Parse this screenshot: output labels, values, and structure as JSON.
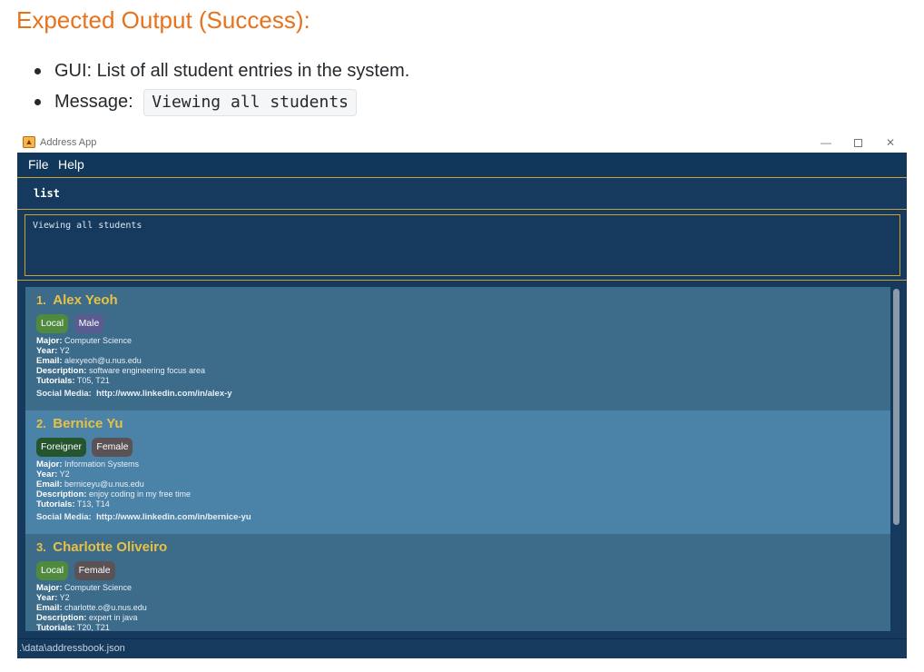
{
  "doc": {
    "heading": "Expected Output (Success):",
    "bullets": [
      "GUI: List of all student entries in the system.",
      "Message:"
    ],
    "message_code": "Viewing all students"
  },
  "window": {
    "title": "Address App",
    "minimize": "—",
    "close": "✕"
  },
  "menu": {
    "file": "File",
    "help": "Help"
  },
  "command": {
    "value": "list"
  },
  "result": {
    "text": "Viewing all students"
  },
  "labels": {
    "major": "Major:",
    "year": "Year:",
    "email": "Email:",
    "description": "Description:",
    "tutorials": "Tutorials:",
    "social": "Social Media:"
  },
  "students": [
    {
      "index": "1.",
      "name": "Alex Yeoh",
      "tags": [
        "Local",
        "Male"
      ],
      "major": "Computer Science",
      "year": "Y2",
      "email": "alexyeoh@u.nus.edu",
      "description": "software engineering focus area",
      "tutorials": "T05, T21",
      "social": "http://www.linkedin.com/in/alex-y"
    },
    {
      "index": "2.",
      "name": "Bernice Yu",
      "tags": [
        "Foreigner",
        "Female"
      ],
      "major": "Information Systems",
      "year": "Y2",
      "email": "berniceyu@u.nus.edu",
      "description": "enjoy coding in my free time",
      "tutorials": "T13, T14",
      "social": "http://www.linkedin.com/in/bernice-yu"
    },
    {
      "index": "3.",
      "name": "Charlotte Oliveiro",
      "tags": [
        "Local",
        "Female"
      ],
      "major": "Computer Science",
      "year": "Y2",
      "email": "charlotte.o@u.nus.edu",
      "description": "expert in java",
      "tutorials": "T20, T21"
    }
  ],
  "status": {
    "path": ".\\data\\addressbook.json"
  }
}
